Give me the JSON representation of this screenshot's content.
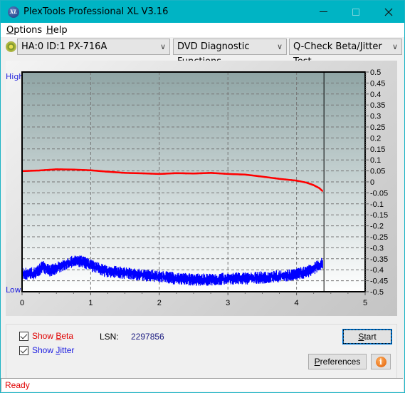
{
  "window": {
    "title": "PlexTools Professional XL V3.16",
    "app_icon_text": "XL",
    "controls": [
      "minimize",
      "maximize",
      "close"
    ]
  },
  "menu": {
    "items": [
      {
        "label": "Options",
        "accel": "O"
      },
      {
        "label": "Help",
        "accel": "H"
      }
    ]
  },
  "toolbar": {
    "drive_select": "HA:0 ID:1  PX-716A",
    "function_select": "DVD Diagnostic Functions",
    "test_select": "Q-Check Beta/Jitter Test"
  },
  "chart": {
    "high_label": "High",
    "low_label": "Low"
  },
  "chart_data": {
    "type": "line",
    "title": "",
    "xlabel": "",
    "ylabel": "",
    "xlim": [
      0,
      5
    ],
    "ylim": [
      -0.5,
      0.5
    ],
    "x_ticks": [
      "0",
      "1",
      "2",
      "3",
      "4",
      "5"
    ],
    "y_ticks": [
      "0.5",
      "0.45",
      "0.4",
      "0.35",
      "0.3",
      "0.25",
      "0.2",
      "0.15",
      "0.1",
      "0.05",
      "0",
      "-0.05",
      "-0.1",
      "-0.15",
      "-0.2",
      "-0.25",
      "-0.3",
      "-0.35",
      "-0.4",
      "-0.45",
      "-0.5"
    ],
    "grid": true,
    "cursor_x": 4.4,
    "series": [
      {
        "name": "Beta",
        "color": "#ff0000",
        "x": [
          0,
          0.25,
          0.5,
          0.75,
          1.0,
          1.25,
          1.5,
          1.75,
          2.0,
          2.25,
          2.5,
          2.75,
          3.0,
          3.25,
          3.5,
          3.75,
          4.0,
          4.15,
          4.25,
          4.33,
          4.38
        ],
        "values": [
          0.049,
          0.052,
          0.057,
          0.056,
          0.053,
          0.046,
          0.041,
          0.039,
          0.036,
          0.04,
          0.038,
          0.041,
          0.036,
          0.033,
          0.024,
          0.014,
          0.006,
          -0.004,
          -0.015,
          -0.028,
          -0.042
        ]
      },
      {
        "name": "Jitter",
        "color": "#0000ff",
        "x": [
          0,
          0.2,
          0.3,
          0.4,
          0.5,
          0.65,
          0.8,
          0.9,
          1.0,
          1.2,
          1.5,
          1.75,
          2.0,
          2.25,
          2.5,
          2.75,
          3.0,
          3.25,
          3.5,
          3.75,
          4.0,
          4.15,
          4.25,
          4.33,
          4.38
        ],
        "values": [
          -0.42,
          -0.415,
          -0.385,
          -0.405,
          -0.395,
          -0.37,
          -0.36,
          -0.365,
          -0.38,
          -0.405,
          -0.415,
          -0.425,
          -0.43,
          -0.44,
          -0.445,
          -0.445,
          -0.44,
          -0.44,
          -0.435,
          -0.43,
          -0.42,
          -0.41,
          -0.395,
          -0.38,
          -0.37
        ]
      }
    ]
  },
  "controls": {
    "show_beta": {
      "label_pre": "Show ",
      "accel": "B",
      "label_post": "eta",
      "checked": true,
      "color": "#e00000"
    },
    "show_jitter": {
      "label_pre": "Show ",
      "accel": "J",
      "label_post": "itter",
      "checked": true,
      "color": "#1a1ae0"
    },
    "lsn_label": "LSN:",
    "lsn_value": "2297856",
    "start_button": {
      "accel": "S",
      "rest": "tart"
    },
    "preferences_button": {
      "accel": "P",
      "rest": "references"
    },
    "info_icon_text": "i"
  },
  "status": {
    "text": "Ready"
  }
}
